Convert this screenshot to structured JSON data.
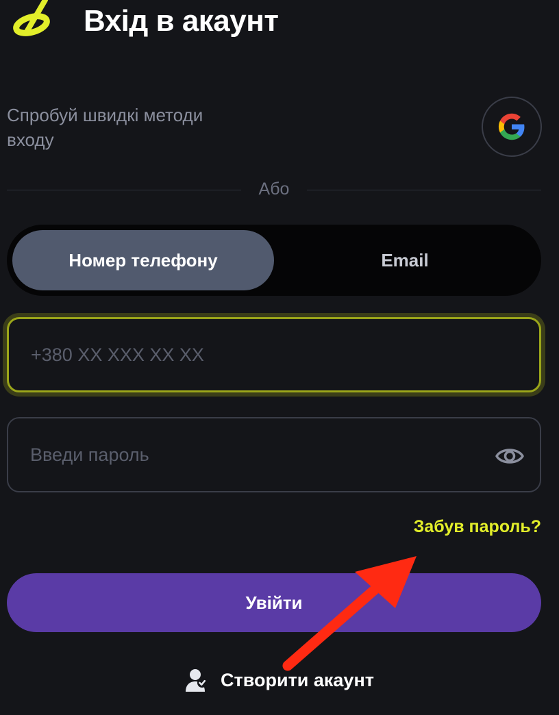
{
  "header": {
    "title": "Вхід в акаунт",
    "logo_icon": "brand-logo-icon",
    "brand_color": "#e2ee2a"
  },
  "quick_login": {
    "text": "Спробуй швидкі методи входу",
    "google_icon": "google-icon"
  },
  "divider": {
    "label": "Або"
  },
  "tabs": [
    {
      "label": "Номер телефону",
      "active": true
    },
    {
      "label": "Email",
      "active": false
    }
  ],
  "phone_field": {
    "placeholder": "+380 XX XXX XX XX",
    "value": "",
    "focused": true,
    "focus_color": "#9ba61a"
  },
  "password_field": {
    "placeholder": "Введи пароль",
    "value": "",
    "toggle_icon": "eye-icon"
  },
  "forgot_link": {
    "label": "Забув пароль?",
    "color": "#e2ee2a"
  },
  "submit": {
    "label": "Увійти",
    "color": "#5a3ba6"
  },
  "create_account": {
    "label": "Створити акаунт",
    "icon": "user-check-icon"
  },
  "annotation": {
    "icon": "red-arrow-annotation",
    "color": "#ff2a12"
  }
}
